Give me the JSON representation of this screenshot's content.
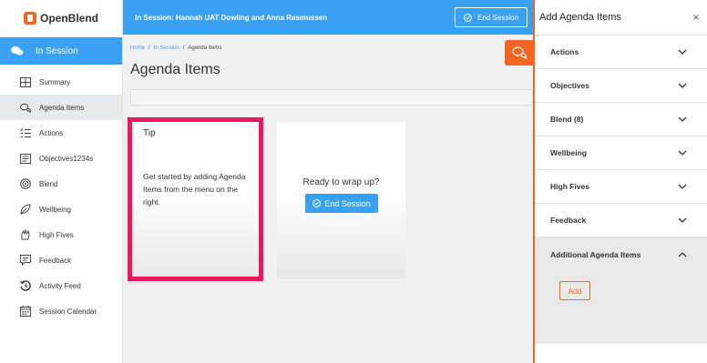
{
  "brand": {
    "name": "OpenBlend"
  },
  "sidebar": {
    "session_label": "In Session",
    "items": [
      {
        "label": "Summary",
        "icon": "summary-grid-icon",
        "active": false
      },
      {
        "label": "Agenda Items",
        "icon": "chat-bubbles-icon",
        "active": true
      },
      {
        "label": "Actions",
        "icon": "checklist-icon",
        "active": false
      },
      {
        "label": "Objectives1234s",
        "icon": "objectives-icon",
        "active": false
      },
      {
        "label": "Blend",
        "icon": "target-icon",
        "active": false
      },
      {
        "label": "Wellbeing",
        "icon": "leaf-icon",
        "active": false
      },
      {
        "label": "High Fives",
        "icon": "high-five-icon",
        "active": false
      },
      {
        "label": "Feedback",
        "icon": "feedback-icon",
        "active": false
      },
      {
        "label": "Activity Feed",
        "icon": "history-icon",
        "active": false
      },
      {
        "label": "Session Calendar",
        "icon": "calendar-icon",
        "active": false
      }
    ]
  },
  "topbar": {
    "title": "In Session: Hannah UAT Dowling and Anna Rasmussen",
    "end_session_label": "End Session"
  },
  "main": {
    "breadcrumb": [
      "Home",
      "/",
      "In Session",
      "/",
      "Agenda Items"
    ],
    "title": "Agenda Items",
    "tip_card": {
      "title": "Tip",
      "body": "Get started by adding Agenda Items from the menu on the right."
    },
    "wrap_card": {
      "question": "Ready to wrap up?",
      "button_label": "End Session"
    }
  },
  "panel": {
    "title": "Add Agenda Items",
    "close": "×",
    "sections": [
      {
        "label": "Actions",
        "open": false
      },
      {
        "label": "Objectives",
        "open": false
      },
      {
        "label": "Blend (8)",
        "open": false
      },
      {
        "label": "Wellbeing",
        "open": false
      },
      {
        "label": "High Fives",
        "open": false
      },
      {
        "label": "Feedback",
        "open": false
      },
      {
        "label": "Additional Agenda Items",
        "open": true
      }
    ],
    "add_label": "Add"
  },
  "colors": {
    "primary_blue": "#3aa1f2",
    "accent_orange": "#f26522",
    "tip_border": "#e8195c"
  }
}
